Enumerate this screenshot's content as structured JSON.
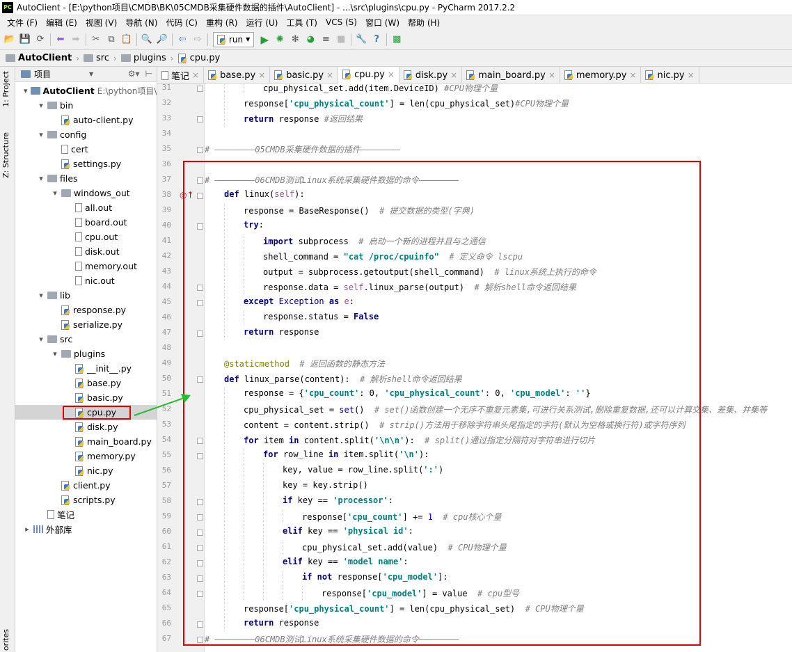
{
  "title": "AutoClient - [E:\\python项目\\CMDB\\BK\\05CMDB采集硬件数据的插件\\AutoClient] - ...\\src\\plugins\\cpu.py - PyCharm 2017.2.2",
  "logo_text": "PC",
  "menu": [
    "文件 (F)",
    "编辑 (E)",
    "视图 (V)",
    "导航 (N)",
    "代码 (C)",
    "重构 (R)",
    "运行 (U)",
    "工具 (T)",
    "VCS (S)",
    "窗口 (W)",
    "帮助 (H)"
  ],
  "toolbar": {
    "run_config": "run",
    "accent": "#23a033"
  },
  "breadcrumb": [
    "AutoClient",
    "src",
    "plugins",
    "cpu.py"
  ],
  "sidebar_tabs": [
    "1: Project",
    "Z: Structure",
    "orites"
  ],
  "project_panel": {
    "title": "项目"
  },
  "tree": [
    {
      "label": "AutoClient",
      "path": "E:\\python项目\\C",
      "depth": 0,
      "type": "root",
      "expanded": true
    },
    {
      "label": "bin",
      "depth": 1,
      "type": "folder",
      "expanded": true
    },
    {
      "label": "auto-client.py",
      "depth": 2,
      "type": "py"
    },
    {
      "label": "config",
      "depth": 1,
      "type": "folder",
      "expanded": true
    },
    {
      "label": "cert",
      "depth": 2,
      "type": "file"
    },
    {
      "label": "settings.py",
      "depth": 2,
      "type": "py"
    },
    {
      "label": "files",
      "depth": 1,
      "type": "folder",
      "expanded": true
    },
    {
      "label": "windows_out",
      "depth": 2,
      "type": "folder",
      "expanded": true
    },
    {
      "label": "all.out",
      "depth": 3,
      "type": "file"
    },
    {
      "label": "board.out",
      "depth": 3,
      "type": "file"
    },
    {
      "label": "cpu.out",
      "depth": 3,
      "type": "file"
    },
    {
      "label": "disk.out",
      "depth": 3,
      "type": "file"
    },
    {
      "label": "memory.out",
      "depth": 3,
      "type": "file"
    },
    {
      "label": "nic.out",
      "depth": 3,
      "type": "file"
    },
    {
      "label": "lib",
      "depth": 1,
      "type": "folder",
      "expanded": true
    },
    {
      "label": "response.py",
      "depth": 2,
      "type": "py"
    },
    {
      "label": "serialize.py",
      "depth": 2,
      "type": "py"
    },
    {
      "label": "src",
      "depth": 1,
      "type": "folder",
      "expanded": true
    },
    {
      "label": "plugins",
      "depth": 2,
      "type": "folder",
      "expanded": true
    },
    {
      "label": "__init__.py",
      "depth": 3,
      "type": "py"
    },
    {
      "label": "base.py",
      "depth": 3,
      "type": "py"
    },
    {
      "label": "basic.py",
      "depth": 3,
      "type": "py"
    },
    {
      "label": "cpu.py",
      "depth": 3,
      "type": "py",
      "selected": true
    },
    {
      "label": "disk.py",
      "depth": 3,
      "type": "py"
    },
    {
      "label": "main_board.py",
      "depth": 3,
      "type": "py"
    },
    {
      "label": "memory.py",
      "depth": 3,
      "type": "py"
    },
    {
      "label": "nic.py",
      "depth": 3,
      "type": "py"
    },
    {
      "label": "client.py",
      "depth": 2,
      "type": "py"
    },
    {
      "label": "scripts.py",
      "depth": 2,
      "type": "py"
    },
    {
      "label": "笔记",
      "depth": 1,
      "type": "file"
    },
    {
      "label": "外部库",
      "depth": 0,
      "type": "lib",
      "expanded": false
    }
  ],
  "tabs": [
    {
      "label": "笔记",
      "type": "file"
    },
    {
      "label": "base.py",
      "type": "py"
    },
    {
      "label": "basic.py",
      "type": "py"
    },
    {
      "label": "cpu.py",
      "type": "py",
      "active": true
    },
    {
      "label": "disk.py",
      "type": "py"
    },
    {
      "label": "main_board.py",
      "type": "py"
    },
    {
      "label": "memory.py",
      "type": "py"
    },
    {
      "label": "nic.py",
      "type": "py"
    }
  ],
  "code": [
    {
      "n": 31,
      "indent": 3,
      "t": [
        [
          "",
          "cpu_physical_set.add(item.DeviceID) "
        ],
        [
          "cm",
          "#CPU物理个量"
        ]
      ]
    },
    {
      "n": 32,
      "indent": 2,
      "t": [
        [
          "",
          "response["
        ],
        [
          "st",
          "'cpu_physical_count'"
        ],
        [
          "",
          "] = len(cpu_physical_set)"
        ],
        [
          "cm",
          "#CPU物理个量"
        ]
      ]
    },
    {
      "n": 33,
      "indent": 2,
      "t": [
        [
          "kw",
          "return"
        ],
        [
          "",
          " response "
        ],
        [
          "cm",
          "#返回结果"
        ]
      ]
    },
    {
      "n": 34,
      "indent": 0,
      "t": []
    },
    {
      "n": 35,
      "indent": 0,
      "t": [
        [
          "cm",
          "# ————————05CMDB采集硬件数据的插件————————"
        ]
      ]
    },
    {
      "n": 36,
      "indent": 0,
      "t": []
    },
    {
      "n": 37,
      "indent": 0,
      "t": [
        [
          "cm",
          "# ————————06CMDB测试Linux系统采集硬件数据的命令————————"
        ]
      ]
    },
    {
      "n": 38,
      "indent": 1,
      "t": [
        [
          "kw",
          "def"
        ],
        [
          "",
          " linux("
        ],
        [
          "sf",
          "self"
        ],
        [
          "",
          "):"
        ]
      ]
    },
    {
      "n": 39,
      "indent": 2,
      "t": [
        [
          "",
          "response = BaseResponse()  "
        ],
        [
          "cm",
          "# 提交数据的类型(字典)"
        ]
      ]
    },
    {
      "n": 40,
      "indent": 2,
      "t": [
        [
          "kw",
          "try"
        ],
        [
          "",
          ":"
        ]
      ]
    },
    {
      "n": 41,
      "indent": 3,
      "t": [
        [
          "kw",
          "import"
        ],
        [
          "",
          " subprocess  "
        ],
        [
          "cm",
          "# 启动一个新的进程并且与之通信"
        ]
      ]
    },
    {
      "n": 42,
      "indent": 3,
      "t": [
        [
          "",
          "shell_command = "
        ],
        [
          "st",
          "\"cat /proc/cpuinfo\""
        ],
        [
          "",
          "  "
        ],
        [
          "cm",
          "# 定义命令 lscpu"
        ]
      ]
    },
    {
      "n": 43,
      "indent": 3,
      "t": [
        [
          "",
          "output = subprocess.getoutput(shell_command)  "
        ],
        [
          "cm",
          "# linux系统上执行的命令"
        ]
      ]
    },
    {
      "n": 44,
      "indent": 3,
      "t": [
        [
          "",
          "response.data = "
        ],
        [
          "sf",
          "self"
        ],
        [
          "",
          ".linux_parse(output)  "
        ],
        [
          "cm",
          "# 解析shell命令返回结果"
        ]
      ]
    },
    {
      "n": 45,
      "indent": 2,
      "t": [
        [
          "kw",
          "except"
        ],
        [
          "",
          " "
        ],
        [
          "bi",
          "Exception"
        ],
        [
          "",
          " "
        ],
        [
          "kw",
          "as"
        ],
        [
          "",
          " "
        ],
        [
          "sf",
          "e"
        ],
        [
          "",
          ":"
        ]
      ]
    },
    {
      "n": 46,
      "indent": 3,
      "t": [
        [
          "",
          "response.status = "
        ],
        [
          "kw",
          "False"
        ]
      ]
    },
    {
      "n": 47,
      "indent": 2,
      "t": [
        [
          "kw",
          "return"
        ],
        [
          "",
          " response"
        ]
      ]
    },
    {
      "n": 48,
      "indent": 0,
      "t": []
    },
    {
      "n": 49,
      "indent": 1,
      "t": [
        [
          "dc",
          "@staticmethod"
        ],
        [
          "",
          "  "
        ],
        [
          "cm",
          "# 返回函数的静态方法"
        ]
      ]
    },
    {
      "n": 50,
      "indent": 1,
      "t": [
        [
          "kw",
          "def"
        ],
        [
          "",
          " linux_parse(content):  "
        ],
        [
          "cm",
          "# 解析shell命令返回结果"
        ]
      ]
    },
    {
      "n": 51,
      "indent": 2,
      "t": [
        [
          "",
          "response = {"
        ],
        [
          "st",
          "'cpu_count'"
        ],
        [
          "",
          ": 0, "
        ],
        [
          "st",
          "'cpu_physical_count'"
        ],
        [
          "",
          ": 0, "
        ],
        [
          "st",
          "'cpu_model'"
        ],
        [
          "",
          ": "
        ],
        [
          "st",
          "''"
        ],
        [
          "",
          "}"
        ]
      ]
    },
    {
      "n": 52,
      "indent": 2,
      "t": [
        [
          "",
          "cpu_physical_set = "
        ],
        [
          "bi",
          "set"
        ],
        [
          "",
          "()  "
        ],
        [
          "cm",
          "# set()函数创建一个无序不重复元素集,可进行关系测试,删除重复数据,还可以计算交集、差集、并集等"
        ]
      ]
    },
    {
      "n": 53,
      "indent": 2,
      "t": [
        [
          "",
          "content = content.strip()  "
        ],
        [
          "cm",
          "# strip()方法用于移除字符串头尾指定的字符(默认为空格或换行符)或字符序列"
        ]
      ]
    },
    {
      "n": 54,
      "indent": 2,
      "t": [
        [
          "kw",
          "for"
        ],
        [
          "",
          " item "
        ],
        [
          "kw",
          "in"
        ],
        [
          "",
          " content.split("
        ],
        [
          "st",
          "'\\n\\n'"
        ],
        [
          "",
          "):  "
        ],
        [
          "cm",
          "# split()通过指定分隔符对字符串进行切片"
        ]
      ]
    },
    {
      "n": 55,
      "indent": 3,
      "t": [
        [
          "kw",
          "for"
        ],
        [
          "",
          " row_line "
        ],
        [
          "kw",
          "in"
        ],
        [
          "",
          " item.split("
        ],
        [
          "st",
          "'\\n'"
        ],
        [
          "",
          "):"
        ]
      ]
    },
    {
      "n": 56,
      "indent": 4,
      "t": [
        [
          "",
          "key, value = row_line.split("
        ],
        [
          "st",
          "':'"
        ],
        [
          "",
          ")"
        ]
      ]
    },
    {
      "n": 57,
      "indent": 4,
      "t": [
        [
          "",
          "key = key.strip()"
        ]
      ]
    },
    {
      "n": 58,
      "indent": 4,
      "t": [
        [
          "kw",
          "if"
        ],
        [
          "",
          " key == "
        ],
        [
          "st",
          "'processor'"
        ],
        [
          "",
          ":"
        ]
      ]
    },
    {
      "n": 59,
      "indent": 5,
      "t": [
        [
          "",
          "response["
        ],
        [
          "st",
          "'cpu_count'"
        ],
        [
          "",
          "] += "
        ],
        [
          "nm",
          "1"
        ],
        [
          "",
          "  "
        ],
        [
          "cm",
          "# cpu核心个量"
        ]
      ]
    },
    {
      "n": 60,
      "indent": 4,
      "t": [
        [
          "kw",
          "elif"
        ],
        [
          "",
          " key == "
        ],
        [
          "st",
          "'physical id'"
        ],
        [
          "",
          ":"
        ]
      ]
    },
    {
      "n": 61,
      "indent": 5,
      "t": [
        [
          "",
          "cpu_physical_set.add(value)  "
        ],
        [
          "cm",
          "# CPU物理个量"
        ]
      ]
    },
    {
      "n": 62,
      "indent": 4,
      "t": [
        [
          "kw",
          "elif"
        ],
        [
          "",
          " key == "
        ],
        [
          "st",
          "'model name'"
        ],
        [
          "",
          ":"
        ]
      ]
    },
    {
      "n": 63,
      "indent": 5,
      "t": [
        [
          "kw",
          "if not"
        ],
        [
          "",
          " response["
        ],
        [
          "st",
          "'cpu_model'"
        ],
        [
          "",
          "]:"
        ]
      ]
    },
    {
      "n": 64,
      "indent": 6,
      "t": [
        [
          "",
          "response["
        ],
        [
          "st",
          "'cpu_model'"
        ],
        [
          "",
          "] = value  "
        ],
        [
          "cm",
          "# cpu型号"
        ]
      ]
    },
    {
      "n": 65,
      "indent": 2,
      "t": [
        [
          "",
          "response["
        ],
        [
          "st",
          "'cpu_physical_count'"
        ],
        [
          "",
          "] = len(cpu_physical_set)  "
        ],
        [
          "cm",
          "# CPU物理个量"
        ]
      ]
    },
    {
      "n": 66,
      "indent": 2,
      "t": [
        [
          "kw",
          "return"
        ],
        [
          "",
          " response"
        ]
      ]
    },
    {
      "n": 67,
      "indent": 0,
      "t": [
        [
          "cm",
          "# ————————06CMDB测试Linux系统采集硬件数据的命令————————"
        ]
      ]
    }
  ],
  "folds": [
    31,
    33,
    35,
    37,
    38,
    40,
    44,
    45,
    47,
    50,
    54,
    55,
    58,
    59,
    60,
    61,
    62,
    63,
    64,
    66,
    67
  ],
  "annotation_color": "#e00000",
  "arrow_color": "#22c02a"
}
